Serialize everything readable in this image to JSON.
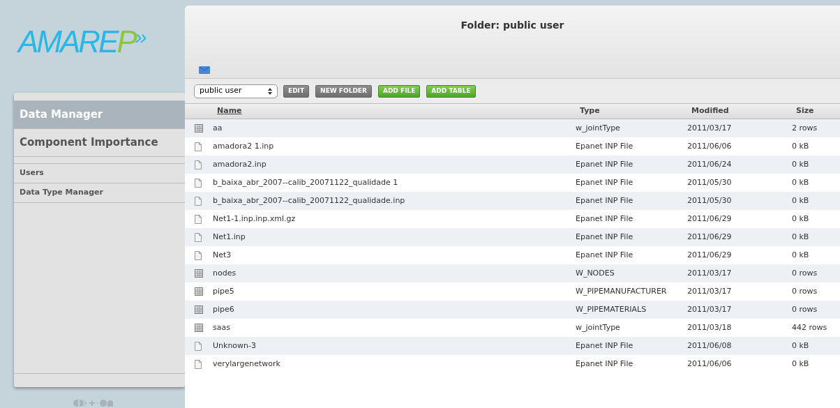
{
  "logo": {
    "text": "AMARE",
    "accent": "P",
    "mark": "»"
  },
  "sidebar": {
    "main_items": [
      {
        "label": "Data Manager",
        "selected": true
      },
      {
        "label": "Component Importance",
        "selected": false
      }
    ],
    "sub_items": [
      {
        "label": "Users",
        "selected": false
      },
      {
        "label": "Data Type Manager",
        "selected": false
      }
    ]
  },
  "folder": {
    "title": "Folder: public user"
  },
  "toolbar": {
    "folder_select": "public user",
    "buttons": [
      {
        "label": "EDIT",
        "disabled": true
      },
      {
        "label": "NEW FOLDER",
        "disabled": true
      },
      {
        "label": "ADD FILE",
        "disabled": false
      },
      {
        "label": "ADD TABLE",
        "disabled": false
      }
    ]
  },
  "table": {
    "columns": [
      "Name",
      "Type",
      "Modified",
      "Size"
    ],
    "rows": [
      {
        "kind": "table",
        "name": "aa",
        "type": "w_jointType",
        "modified": "2011/03/17",
        "size": "2 rows"
      },
      {
        "kind": "file",
        "name": "amadora2 1.inp",
        "type": "Epanet INP File",
        "modified": "2011/06/06",
        "size": "0 kB"
      },
      {
        "kind": "file",
        "name": "amadora2.inp",
        "type": "Epanet INP File",
        "modified": "2011/06/24",
        "size": "0 kB"
      },
      {
        "kind": "file",
        "name": "b_baixa_abr_2007--calib_20071122_qualidade 1",
        "type": "Epanet INP File",
        "modified": "2011/05/30",
        "size": "0 kB"
      },
      {
        "kind": "file",
        "name": "b_baixa_abr_2007--calib_20071122_qualidade.inp",
        "type": "Epanet INP File",
        "modified": "2011/05/30",
        "size": "0 kB"
      },
      {
        "kind": "file",
        "name": "Net1-1.inp.inp.xml.gz",
        "type": "Epanet INP File",
        "modified": "2011/06/29",
        "size": "0 kB"
      },
      {
        "kind": "file",
        "name": "Net1.inp",
        "type": "Epanet INP File",
        "modified": "2011/06/29",
        "size": "0 kB"
      },
      {
        "kind": "file",
        "name": "Net3",
        "type": "Epanet INP File",
        "modified": "2011/06/29",
        "size": "0 kB"
      },
      {
        "kind": "table",
        "name": "nodes",
        "type": "W_NODES",
        "modified": "2011/03/17",
        "size": "0 rows"
      },
      {
        "kind": "table",
        "name": "pipe5",
        "type": "W_PIPEMANUFACTURER",
        "modified": "2011/03/17",
        "size": "0 rows"
      },
      {
        "kind": "table",
        "name": "pipe6",
        "type": "W_PIPEMATERIALS",
        "modified": "2011/03/17",
        "size": "0 rows"
      },
      {
        "kind": "table",
        "name": "saas",
        "type": "w_jointType",
        "modified": "2011/03/18",
        "size": "442 rows"
      },
      {
        "kind": "file",
        "name": "Unknown-3",
        "type": "Epanet INP File",
        "modified": "2011/06/08",
        "size": "0 kB"
      },
      {
        "kind": "file",
        "name": "verylargenetwork",
        "type": "Epanet INP File",
        "modified": "2011/06/06",
        "size": "0 kB"
      }
    ]
  }
}
